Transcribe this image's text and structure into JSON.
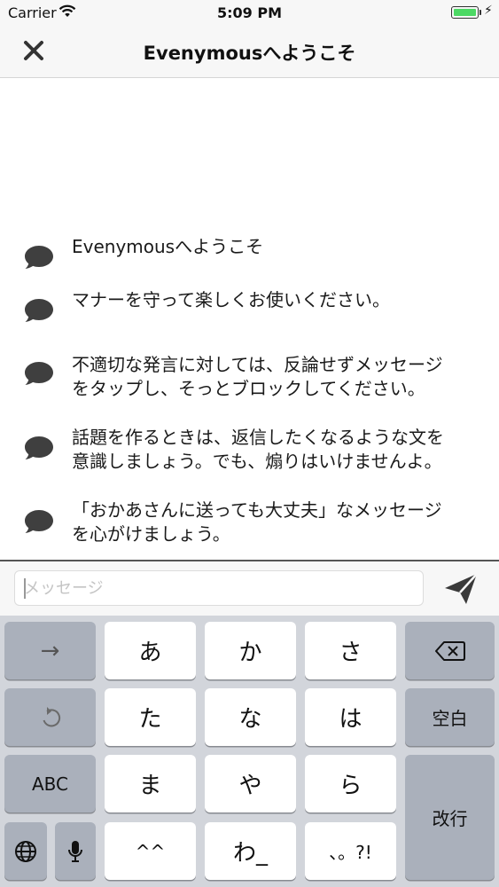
{
  "status_bar": {
    "carrier": "Carrier",
    "time": "5:09 PM",
    "battery_color": "#4cd964"
  },
  "nav": {
    "title": "Evenymousへようこそ",
    "close_icon": "close-icon"
  },
  "messages": [
    {
      "icon": "speech-bubble-icon",
      "text": "Evenymousへようこそ"
    },
    {
      "icon": "speech-bubble-icon",
      "text": "マナーを守って楽しくお使いください。"
    },
    {
      "icon": "speech-bubble-icon",
      "text": "不適切な発言に対しては、反論せずメッセージ\nをタップし、そっとブロックしてください。"
    },
    {
      "icon": "speech-bubble-icon",
      "text": "話題を作るときは、返信したくなるような文を\n意識しましょう。でも、煽りはいけませんよ。"
    },
    {
      "icon": "speech-bubble-icon",
      "text": "「おかあさんに送っても大丈夫」なメッセージ\nを心がけましょう。"
    }
  ],
  "input": {
    "placeholder": "メッセージ",
    "value": ""
  },
  "keyboard": {
    "next": "→",
    "undo_icon": "undo-icon",
    "abc": "ABC",
    "globe_icon": "globe-icon",
    "mic_icon": "microphone-icon",
    "row1": [
      "あ",
      "か",
      "さ"
    ],
    "row2": [
      "た",
      "な",
      "は"
    ],
    "row3": [
      "ま",
      "や",
      "ら"
    ],
    "row4": [
      "^^",
      "わ_",
      "、。?!"
    ],
    "delete_icon": "backspace-icon",
    "space": "空白",
    "return": "改行"
  },
  "colors": {
    "icon_gray": "#3f3f3f",
    "keyboard_bg": "#d2d5db",
    "dark_key": "#aab0bb"
  }
}
